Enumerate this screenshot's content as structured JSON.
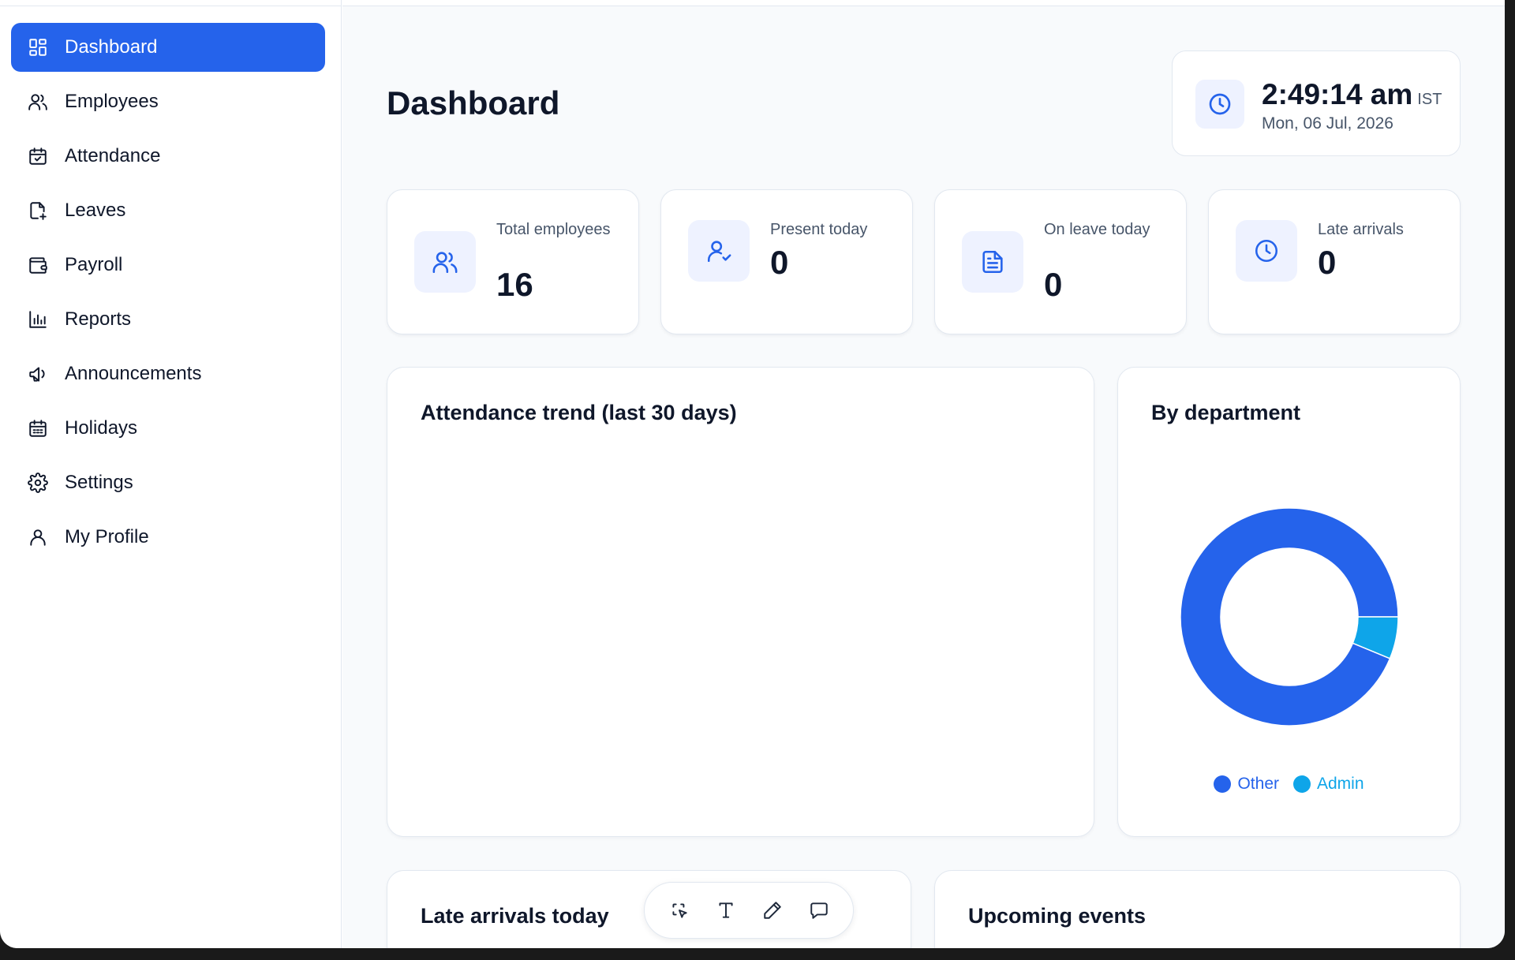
{
  "sidebar": {
    "items": [
      {
        "label": "Dashboard",
        "icon": "dashboard-grid-icon",
        "active": true
      },
      {
        "label": "Employees",
        "icon": "users-icon"
      },
      {
        "label": "Attendance",
        "icon": "calendar-check-icon"
      },
      {
        "label": "Leaves",
        "icon": "file-plus-icon"
      },
      {
        "label": "Payroll",
        "icon": "wallet-icon"
      },
      {
        "label": "Reports",
        "icon": "bar-chart-icon"
      },
      {
        "label": "Announcements",
        "icon": "megaphone-icon"
      },
      {
        "label": "Holidays",
        "icon": "calendar-grid-icon"
      },
      {
        "label": "Settings",
        "icon": "gear-icon"
      },
      {
        "label": "My Profile",
        "icon": "user-icon"
      }
    ]
  },
  "header": {
    "title": "Dashboard",
    "clock": {
      "time": "2:49:14 am",
      "timezone": "IST",
      "date": "Mon, 06 Jul, 2026"
    }
  },
  "stats": [
    {
      "label": "Total employees",
      "value": "16",
      "icon": "users-icon"
    },
    {
      "label": "Present today",
      "value": "0",
      "icon": "user-check-icon"
    },
    {
      "label": "On leave today",
      "value": "0",
      "icon": "document-icon"
    },
    {
      "label": "Late arrivals",
      "value": "0",
      "icon": "clock-icon"
    }
  ],
  "panels": {
    "trend_title": "Attendance trend (last 30 days)",
    "department_title": "By department",
    "late_title": "Late arrivals today",
    "events_title": "Upcoming events"
  },
  "chart_data": {
    "type": "pie",
    "title": "By department",
    "series": [
      {
        "name": "Other",
        "value": 15,
        "color": "#2563eb"
      },
      {
        "name": "Admin",
        "value": 1,
        "color": "#0ea5e9"
      }
    ],
    "legend": "bottom"
  },
  "toolbar": {
    "tools": [
      "select-icon",
      "text-icon",
      "pencil-icon",
      "comment-icon"
    ]
  },
  "colors": {
    "accent": "#2563eb",
    "secondary": "#0ea5e9"
  }
}
